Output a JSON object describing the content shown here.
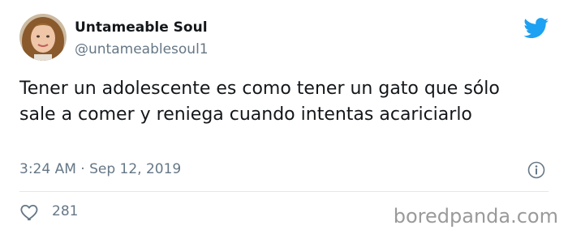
{
  "tweet": {
    "display_name": "Untameable Soul",
    "handle": "@untameablesoul1",
    "text": "Tener un adolescente es como tener un gato que sólo sale a comer y reniega cuando intentas acariciarlo",
    "timestamp": "3:24 AM · Sep 12, 2019",
    "likes": "281"
  },
  "icons": {
    "brand": "twitter-bird-icon",
    "info": "info-icon",
    "like": "heart-icon"
  },
  "colors": {
    "twitter_blue": "#1da1f2",
    "text_primary": "#14171a",
    "text_secondary": "#657786",
    "divider": "#e1e8ed"
  },
  "watermark": "boredpanda.com"
}
